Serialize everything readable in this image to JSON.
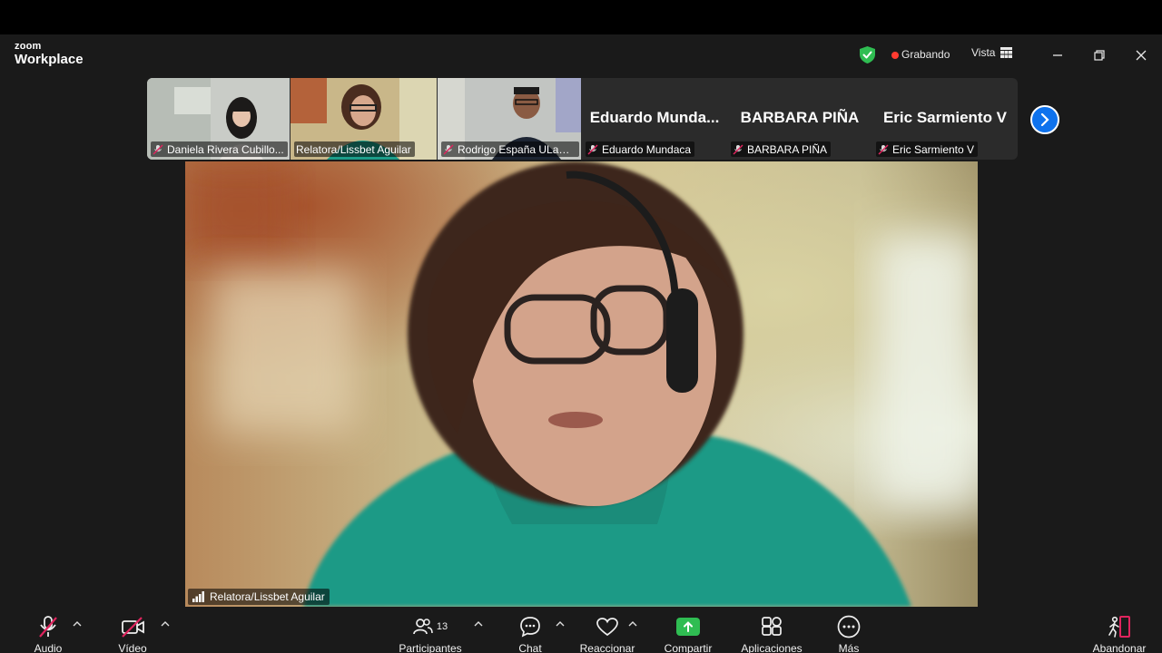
{
  "app": {
    "brand_top": "zoom",
    "brand_bottom": "Workplace"
  },
  "titlebar": {
    "recording_label": "Grabando",
    "view_label": "Vista",
    "recording_color": "#ff3b30",
    "shield_color": "#2fbd52"
  },
  "participants": [
    {
      "name": "Daniela Rivera Cubillo...",
      "muted": true,
      "video": true
    },
    {
      "name": "Relatora/Lissbet Aguilar",
      "muted": false,
      "video": true,
      "active_speaker": true
    },
    {
      "name": "Rodrigo España  ULagos",
      "muted": true,
      "video": true
    },
    {
      "display": "Eduardo   Munda...",
      "name": "Eduardo Mundaca",
      "muted": true,
      "video": false
    },
    {
      "display": "BARBARA PIÑA",
      "name": "BARBARA PIÑA",
      "muted": true,
      "video": false
    },
    {
      "display": "Eric Sarmiento V",
      "name": "Eric Sarmiento V",
      "muted": true,
      "video": false
    }
  ],
  "main_video": {
    "speaker_name": "Relatora/Lissbet Aguilar"
  },
  "toolbar": {
    "audio": "Audio",
    "video": "Vídeo",
    "participants": "Participantes",
    "participants_count": "13",
    "chat": "Chat",
    "react": "Reaccionar",
    "share": "Compartir",
    "apps": "Aplicaciones",
    "more": "Más",
    "leave": "Abandonar"
  },
  "colors": {
    "accent": "#0e72ed",
    "active_border": "#3ccd5a",
    "muted_red": "#e0245e",
    "share_green": "#2fbd52",
    "leave_red": "#e0245e"
  }
}
